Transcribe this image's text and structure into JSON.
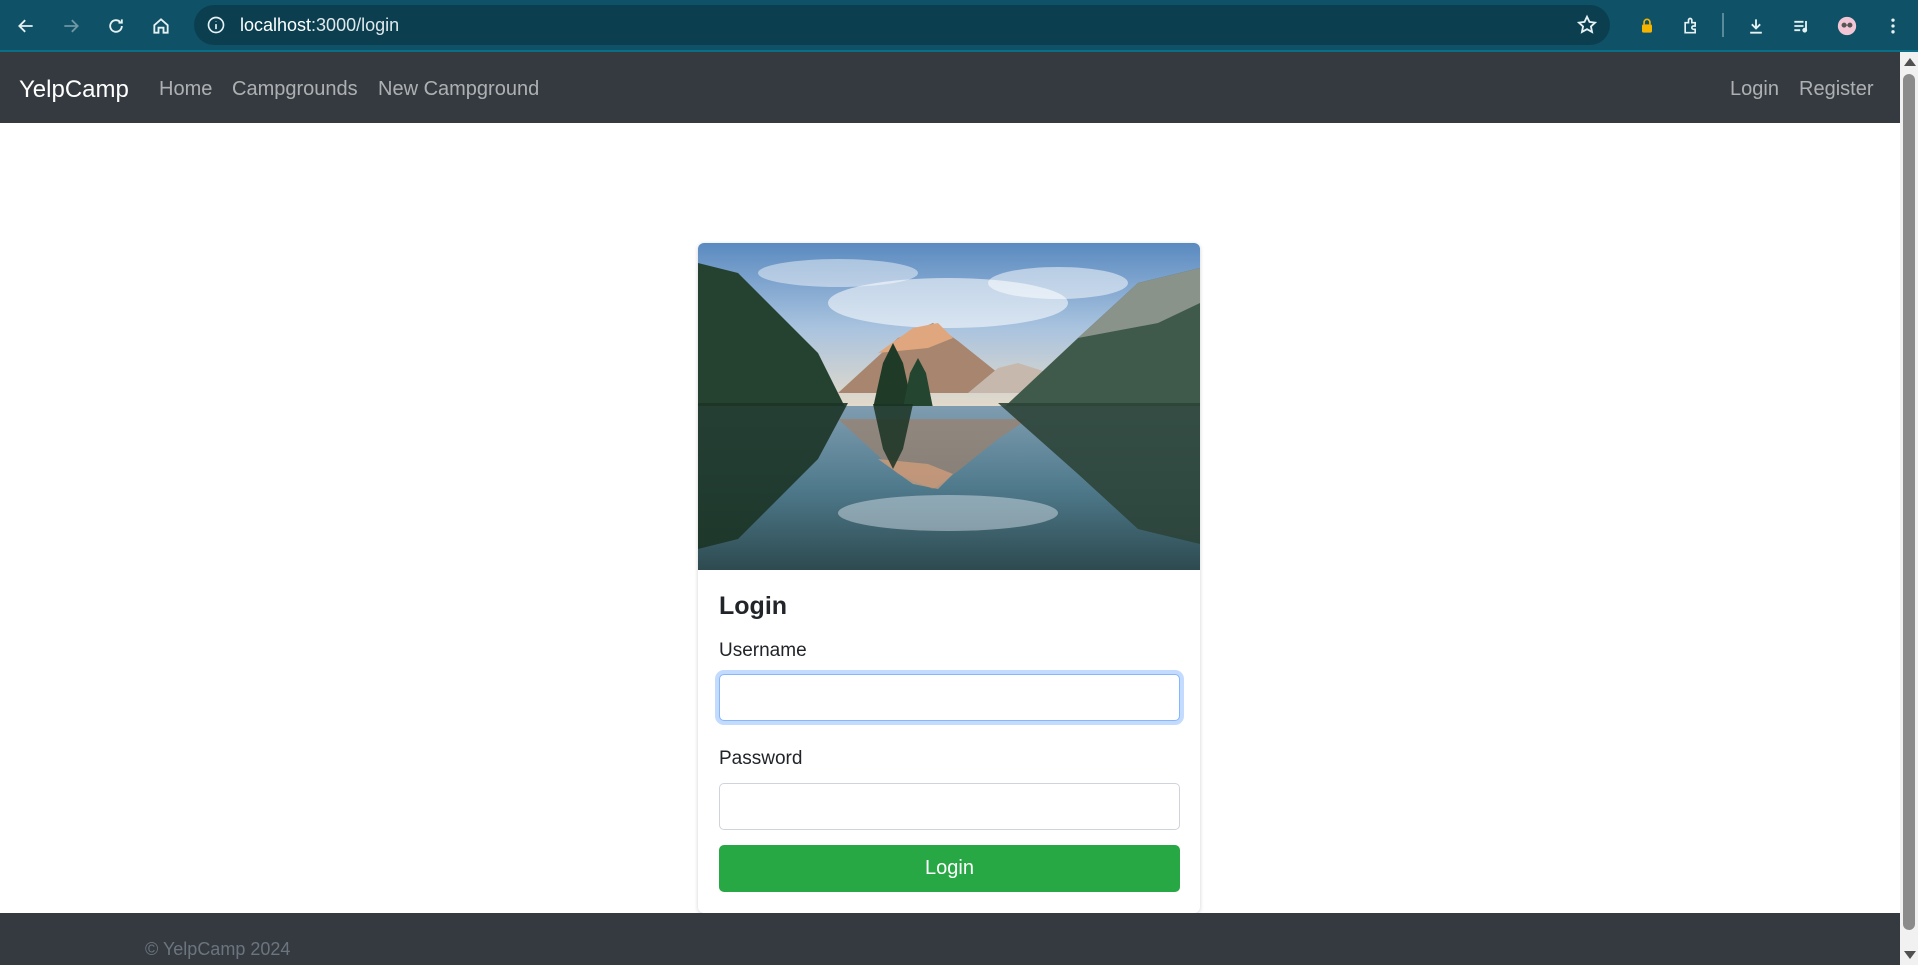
{
  "browser": {
    "url_host": "localhost",
    "url_path": ":3000/login",
    "icons": [
      "back-icon",
      "forward-icon",
      "reload-icon",
      "home-icon",
      "info-icon",
      "star-icon",
      "lock-extension-icon",
      "extensions-icon",
      "download-icon",
      "media-icon",
      "profile-avatar-icon",
      "menu-icon"
    ]
  },
  "navbar": {
    "brand": "YelpCamp",
    "links": [
      {
        "label": "Home"
      },
      {
        "label": "Campgrounds"
      },
      {
        "label": "New Campground"
      }
    ],
    "right_links": [
      {
        "label": "Login"
      },
      {
        "label": "Register"
      }
    ]
  },
  "card": {
    "title": "Login",
    "username_label": "Username",
    "username_value": "",
    "password_label": "Password",
    "password_value": "",
    "submit_label": "Login"
  },
  "footer": {
    "text": "© YelpCamp 2024"
  },
  "colors": {
    "chrome_bg": "#0f5166",
    "navbar_bg": "#343a40",
    "button_green": "#28a745"
  }
}
